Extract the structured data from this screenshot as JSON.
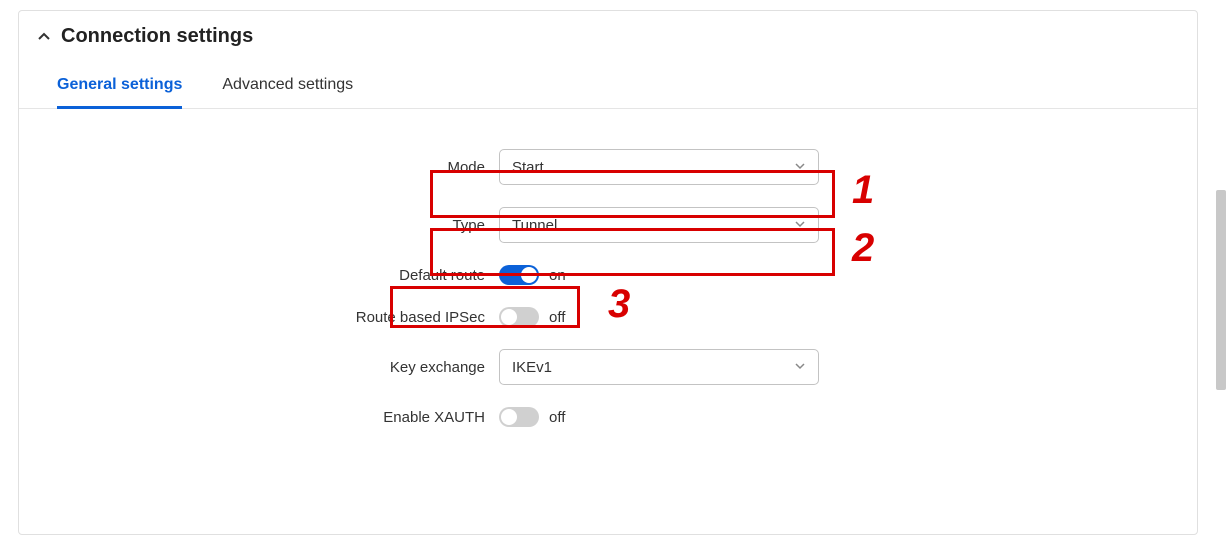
{
  "section": {
    "title": "Connection settings"
  },
  "tabs": {
    "general": "General settings",
    "advanced": "Advanced settings"
  },
  "fields": {
    "mode": {
      "label": "Mode",
      "value": "Start"
    },
    "type": {
      "label": "Type",
      "value": "Tunnel"
    },
    "defaultRoute": {
      "label": "Default route",
      "state": "on"
    },
    "routeBased": {
      "label": "Route based IPSec",
      "state": "off"
    },
    "keyExchange": {
      "label": "Key exchange",
      "value": "IKEv1"
    },
    "enableXauth": {
      "label": "Enable XAUTH",
      "state": "off"
    }
  },
  "annotations": {
    "n1": "1",
    "n2": "2",
    "n3": "3"
  }
}
